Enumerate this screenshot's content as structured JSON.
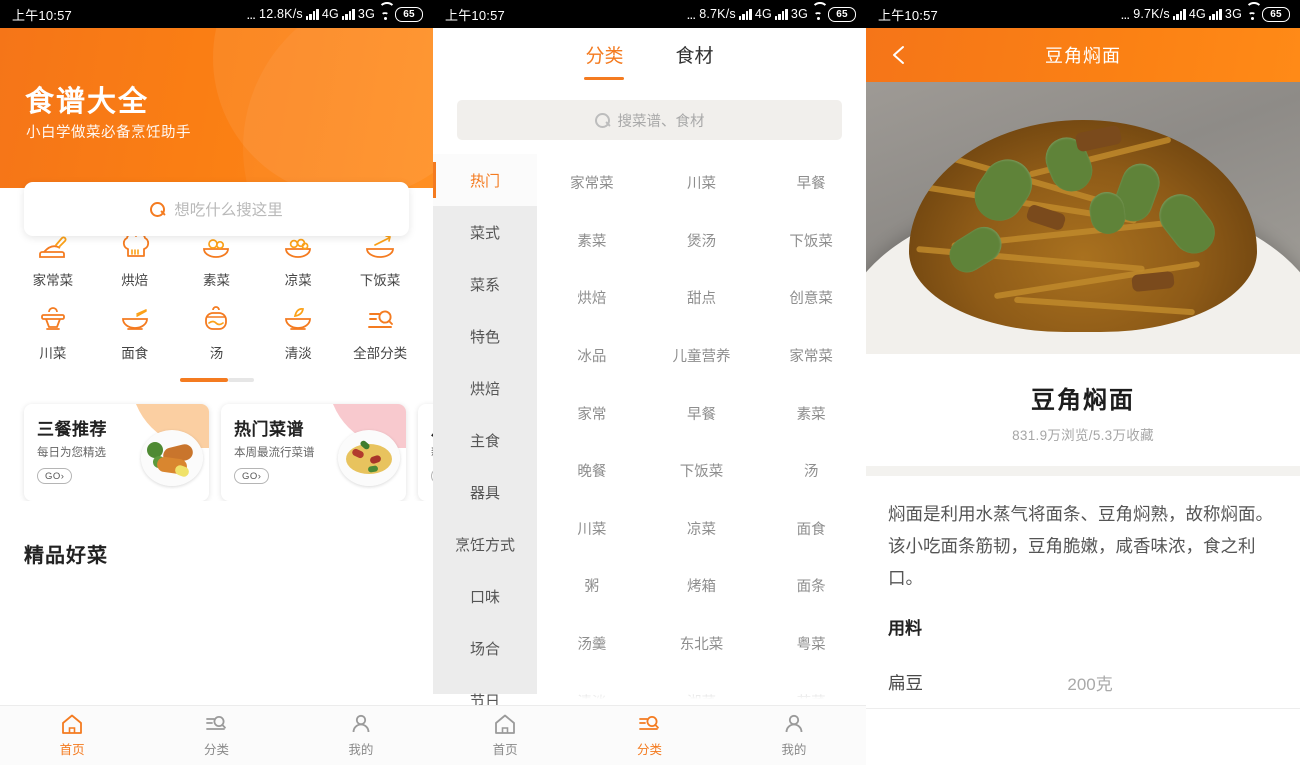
{
  "status_bar": {
    "time": "上午10:57",
    "dots": "...",
    "speeds": [
      "12.8K/s",
      "8.7K/s",
      "9.7K/s"
    ],
    "net_primary": "4G",
    "net_secondary": "3G",
    "battery": "65"
  },
  "colors": {
    "accent": "#F47B20",
    "accent_dark": "#F57518",
    "accent_light": "#FF8A17",
    "text_dark": "#222222",
    "text_muted": "#8e8e8e",
    "sidebar_bg": "#ececec"
  },
  "home": {
    "hero_title": "食谱大全",
    "hero_subtitle": "小白学做菜必备烹饪助手",
    "search_placeholder": "想吃什么搜这里",
    "search_value": "",
    "categories": [
      {
        "label": "家常菜",
        "icon": "home-dish-icon"
      },
      {
        "label": "烘焙",
        "icon": "chef-hat-icon"
      },
      {
        "label": "素菜",
        "icon": "veggie-bowl-icon"
      },
      {
        "label": "凉菜",
        "icon": "cold-dish-icon"
      },
      {
        "label": "下饭菜",
        "icon": "rice-dish-icon"
      },
      {
        "label": "川菜",
        "icon": "sichuan-pot-icon"
      },
      {
        "label": "面食",
        "icon": "noodle-bowl-icon"
      },
      {
        "label": "汤",
        "icon": "soup-pot-icon"
      },
      {
        "label": "清淡",
        "icon": "light-food-icon"
      },
      {
        "label": "全部分类",
        "icon": "all-categories-icon"
      }
    ],
    "promo_cards": [
      {
        "title": "三餐推荐",
        "subtitle": "每日为您精选",
        "cta": "GO›"
      },
      {
        "title": "热门菜谱",
        "subtitle": "本周最流行菜谱",
        "cta": "GO›"
      },
      {
        "title": "八",
        "subtitle": "新",
        "cta": "("
      }
    ],
    "section_title": "精品好菜"
  },
  "bottom_nav": {
    "items": [
      {
        "label": "首页",
        "icon": "home-icon"
      },
      {
        "label": "分类",
        "icon": "category-icon"
      },
      {
        "label": "我的",
        "icon": "user-icon"
      }
    ],
    "active_home": 0,
    "active_category": 1
  },
  "category_page": {
    "tabs": [
      {
        "label": "分类",
        "active": true
      },
      {
        "label": "食材",
        "active": false
      }
    ],
    "search_placeholder": "搜菜谱、食材",
    "search_value": "",
    "sidebar": [
      {
        "label": "热门",
        "active": true
      },
      {
        "label": "菜式",
        "active": false
      },
      {
        "label": "菜系",
        "active": false
      },
      {
        "label": "特色",
        "active": false
      },
      {
        "label": "烘焙",
        "active": false
      },
      {
        "label": "主食",
        "active": false
      },
      {
        "label": "器具",
        "active": false
      },
      {
        "label": "烹饪方式",
        "active": false
      },
      {
        "label": "口味",
        "active": false
      },
      {
        "label": "场合",
        "active": false
      },
      {
        "label": "节日",
        "active": false
      }
    ],
    "grid": [
      "家常菜",
      "川菜",
      "早餐",
      "素菜",
      "煲汤",
      "下饭菜",
      "烘焙",
      "甜点",
      "创意菜",
      "冰品",
      "儿童营养",
      "家常菜",
      "家常",
      "早餐",
      "素菜",
      "晚餐",
      "下饭菜",
      "汤",
      "川菜",
      "凉菜",
      "面食",
      "粥",
      "烤箱",
      "面条",
      "汤羹",
      "东北菜",
      "粤菜",
      "清淡",
      "湘菜",
      "苏菜"
    ]
  },
  "recipe_page": {
    "nav_title": "豆角焖面",
    "back_icon": "chevron-left-icon",
    "dish_image_alt": "豆角焖面 photo",
    "title": "豆角焖面",
    "stats": "831.9万浏览/5.3万收藏",
    "description": "焖面是利用水蒸气将面条、豆角焖熟，故称焖面。该小吃面条筋韧，豆角脆嫩，咸香味浓，食之利口。",
    "ingredients_heading": "用料",
    "ingredients": [
      {
        "name": "扁豆",
        "quantity": "200克"
      }
    ]
  }
}
